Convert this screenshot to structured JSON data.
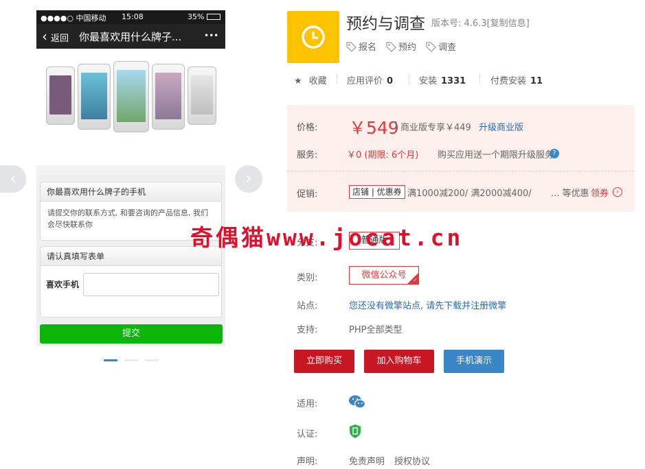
{
  "phone": {
    "carrier": "●●●●○ 中国移动",
    "time": "15:08",
    "battery": "35%",
    "back_label": "返回",
    "page_title": "你最喜欢用什么牌子...",
    "more": "•••"
  },
  "form": {
    "question": "你最喜欢用什么牌子的手机",
    "note": "请提交你的联系方式, 和要咨询的产品信息, 我们会尽快联系你",
    "section": "请认真填写表单",
    "field_label": "喜欢手机",
    "submit": "提交"
  },
  "carousel": {
    "prev": "‹",
    "next": "›"
  },
  "app": {
    "title": "预约与调查",
    "version": "版本号: 4.6.3[复制信息]",
    "tags": [
      "报名",
      "预约",
      "调查"
    ]
  },
  "stats": {
    "favorite": "收藏",
    "rating_label": "应用评价",
    "rating": "0",
    "install_label": "安装",
    "install": "1331",
    "paid_label": "付费安装",
    "paid": "11"
  },
  "price": {
    "label": "价格:",
    "value": "￥549",
    "sep": "|",
    "biz": "商业版专享￥449",
    "upgrade": "升级商业版",
    "service_label": "服务:",
    "service_value": "￥0 (期限: 6个月)",
    "service_desc": "购买应用送一个期限升级服务",
    "help": "?",
    "promo_label": "促销:",
    "promo_badge": "店铺 | 优惠券",
    "promo_text": "满1000减200/ 满2000减400/",
    "promo_more": "... 等优惠",
    "coupon": "领券",
    "coupon_arrow": "›"
  },
  "details": {
    "branch_label": "分支:",
    "branch": "普通版",
    "category_label": "类别:",
    "category": "微信公众号",
    "site_label": "站点:",
    "site": "您还没有微擎站点, 请先下载并注册微擎",
    "support_label": "支持:",
    "support": "PHP全部类型",
    "apply_label": "适用:",
    "cert_label": "认证:",
    "statement_label": "声明:",
    "disclaimer": "免责声明",
    "license": "授权协议"
  },
  "actions": {
    "buy": "立即购买",
    "cart": "加入购物车",
    "demo": "手机演示"
  },
  "watermark": "奇偶猫www.jocat.cn",
  "colors": {
    "accent_red": "#c81623",
    "price_red": "#e4393c",
    "link_blue": "#2a6bb5",
    "app_icon": "#ffc300",
    "submit_green": "#0ab60a"
  }
}
